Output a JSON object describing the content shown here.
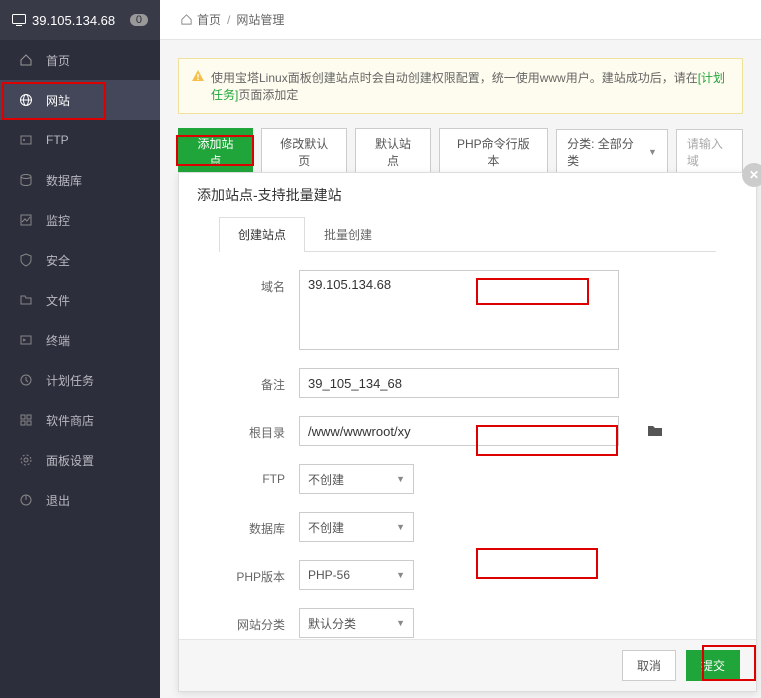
{
  "header": {
    "ip": "39.105.134.68",
    "badge": "0"
  },
  "sidebar": {
    "items": [
      {
        "label": "首页"
      },
      {
        "label": "网站"
      },
      {
        "label": "FTP"
      },
      {
        "label": "数据库"
      },
      {
        "label": "监控"
      },
      {
        "label": "安全"
      },
      {
        "label": "文件"
      },
      {
        "label": "终端"
      },
      {
        "label": "计划任务"
      },
      {
        "label": "软件商店"
      },
      {
        "label": "面板设置"
      },
      {
        "label": "退出"
      }
    ]
  },
  "breadcrumb": {
    "home": "首页",
    "current": "网站管理"
  },
  "notice": {
    "text_before": "使用宝塔Linux面板创建站点时会自动创建权限配置，统一使用www用户。建站成功后，请在",
    "link": "[计划任务]",
    "text_after": "页面添加定"
  },
  "toolbar": {
    "add_site": "添加站点",
    "default_page": "修改默认页",
    "default_site": "默认站点",
    "php_cli": "PHP命令行版本",
    "category_label": "分类: 全部分类",
    "search_placeholder": "请输入域"
  },
  "modal": {
    "title": "添加站点-支持批量建站",
    "tabs": {
      "create": "创建站点",
      "batch": "批量创建"
    },
    "labels": {
      "domain": "域名",
      "remark": "备注",
      "root": "根目录",
      "ftp": "FTP",
      "db": "数据库",
      "php": "PHP版本",
      "category": "网站分类"
    },
    "values": {
      "domain": "39.105.134.68",
      "remark": "39_105_134_68",
      "root": "/www/wwwroot/xy",
      "ftp": "不创建",
      "db": "不创建",
      "php": "PHP-56",
      "category": "默认分类"
    },
    "footer": {
      "cancel": "取消",
      "submit": "提交"
    }
  }
}
